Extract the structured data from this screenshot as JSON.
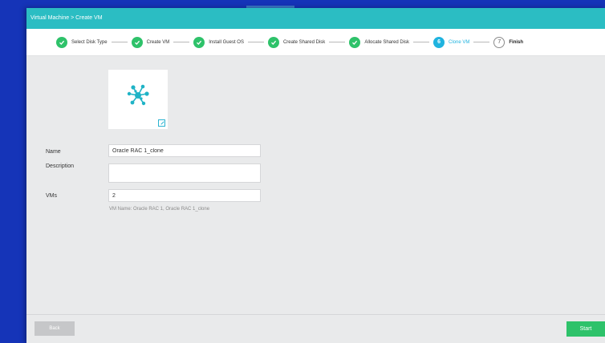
{
  "titlebar": {
    "breadcrumb": "Virtual Machine > Create VM"
  },
  "steps": [
    {
      "label": "Select Disk Type",
      "state": "done"
    },
    {
      "label": "Create VM",
      "state": "done"
    },
    {
      "label": "Install Guest OS",
      "state": "done"
    },
    {
      "label": "Create Shared Disk",
      "state": "done"
    },
    {
      "label": "Allocate Shared Disk",
      "state": "done"
    },
    {
      "label": "Clone VM",
      "state": "current",
      "number": "6"
    },
    {
      "label": "Finish",
      "state": "pending",
      "number": "7"
    }
  ],
  "form": {
    "name_label": "Name",
    "name_value": "Oracle RAC 1_clone",
    "description_label": "Description",
    "description_value": "",
    "vms_label": "VMs",
    "vms_value": "2",
    "vm_name_hint": "VM Name: Oracle RAC 1, Oracle RAC 1_clone"
  },
  "footer": {
    "back_label": "Back",
    "start_label": "Start"
  },
  "colors": {
    "titlebar": "#2bbdc3",
    "step_done": "#2ec26a",
    "step_current": "#1fb3df",
    "start_button": "#2ec26a",
    "back_button_disabled": "#c6c7c9"
  },
  "icons": {
    "vm_avatar": "network-cluster-icon",
    "edit": "edit-icon",
    "check": "check-icon"
  }
}
